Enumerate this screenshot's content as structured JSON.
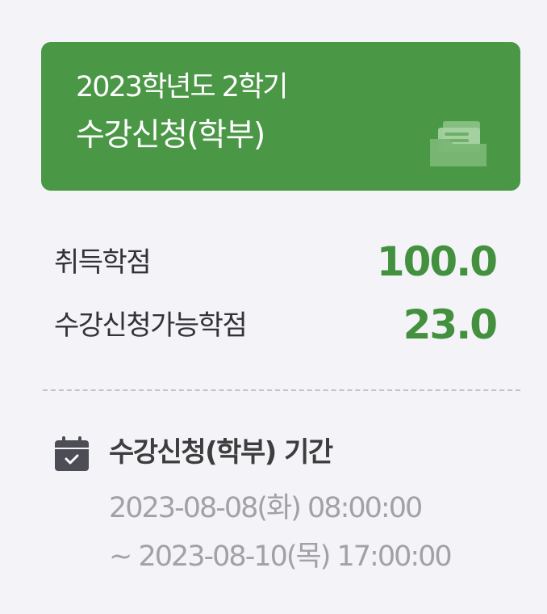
{
  "banner": {
    "term": "2023학년도 2학기",
    "title": "수강신청(학부)",
    "icon": "folder-documents-icon",
    "color": "#4a9746"
  },
  "credits": [
    {
      "label": "취득학점",
      "value": "100.0"
    },
    {
      "label": "수강신청가능학점",
      "value": "23.0"
    }
  ],
  "period": {
    "icon": "calendar-check-icon",
    "title": "수강신청(학부) 기간",
    "start": "2023-08-08(화) 08:00:00",
    "end": "~ 2023-08-10(목) 17:00:00"
  },
  "colors": {
    "accent": "#43913f",
    "background": "#f4f3f8",
    "muted_text": "#a2a2a6"
  }
}
